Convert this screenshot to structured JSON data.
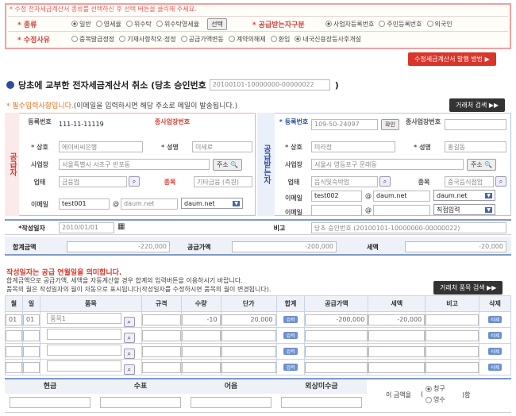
{
  "top": {
    "note": "* 수정 전자세금계산서 종류를 선택하신 후 선택 버튼을 클릭해 주세요.",
    "kind_label": "* 종류",
    "kinds": [
      "일반",
      "영세율",
      "위수탁",
      "위수탁영세율"
    ],
    "select_btn": "선택",
    "recv_label": "* 공급받는자구분",
    "recv": [
      "사업자등록번호",
      "주민등록번호",
      "외국인"
    ],
    "reason_label": "* 수정사유",
    "reasons": [
      "중복발급정정",
      "기재사항착오·정정",
      "공급가액변동",
      "계약의해제",
      "환입",
      "내국신용장등사후개설"
    ],
    "method_btn": "수정세금계산서 발행 방법 ▶"
  },
  "heading": {
    "title": "당초에 교부한 전자세금계산서 취소 (당초 승인번호",
    "approval": "20100101-10000000-00000022",
    "close": ")"
  },
  "required_note": "* 필수입력사항입니다.",
  "required_note2": "(이메일을 입력하시면 해당 주소로 메일이 발송됩니다.)",
  "search_partner": "거래처 검색 ▶▶",
  "supplier": {
    "side": "공급자",
    "reg_label": "등록번호",
    "reg": "111-11-11119",
    "sub_label": "종사업장번호",
    "name_label": "* 상호",
    "name": "에이비씨은행",
    "rep_label": "* 성명",
    "rep": "이세로",
    "addr_label": "사업장",
    "addr": "서울특별시 서초구 반포동",
    "addr_btn": "주소",
    "type_label": "업태",
    "type": "금융업",
    "item_label": "종목",
    "item": "기타금융 (측원)",
    "email_label": "이메일",
    "email_id": "test001",
    "email_domain": "daum.net",
    "email_sel": "daum.net"
  },
  "receiver": {
    "side": "공급받는자",
    "reg_label": "* 등록번호",
    "reg": "109-50-24097",
    "confirm": "확인",
    "sub_label": "종사업장번호",
    "name_label": "* 상호",
    "name": "미라정",
    "rep_label": "* 성명",
    "rep": "홍길동",
    "addr_label": "사업장",
    "addr": "서울시 영등포구 문래동",
    "addr_btn": "주소",
    "type_label": "업태",
    "type": "음식및숙박업",
    "item_label": "종목",
    "item": "중국음식점업",
    "email_label": "이메일",
    "email_id": "test002",
    "email_domain": "daum.net",
    "email_sel": "daum.net",
    "email2_label": "이메일",
    "email2_sel": "직접입력"
  },
  "date_label": "*작성일자",
  "date": "2010/01/01",
  "memo_label": "비고",
  "memo": "당초 승인번호 (20100101-10000000-00000022)",
  "totals": {
    "total_label": "합계금액",
    "total": "-220,000",
    "supply_label": "공급가액",
    "supply": "-200,000",
    "tax_label": "세액",
    "tax": "-20,000"
  },
  "notice": {
    "red": "작성일자는 공급 연월일을 의미합니다.",
    "l1": "합계금액으로 공급가액, 세액을 자동계산할 경우 합계의 입력버튼을 이용하시기 바랍니다.",
    "l2": "품목의 월은 작성일자의 월이 자동으로 표시됩니다(작성일자를 수정하시면 품목의 월이 변경됩니다).",
    "search_items": "거래처 품목 검색 ▶▶"
  },
  "items": {
    "headers": [
      "월",
      "일",
      "품목",
      "규격",
      "수량",
      "단가",
      "합계",
      "공급가액",
      "세액",
      "비고",
      "삭제"
    ],
    "rows": [
      {
        "m": "01",
        "d": "01",
        "name": "품목1",
        "spec": "",
        "qty": "-10",
        "price": "20,000",
        "sum": "입력",
        "supply": "-200,000",
        "tax": "-20,000",
        "note": "",
        "del": "삭제"
      },
      {
        "m": "",
        "d": "",
        "name": "",
        "spec": "",
        "qty": "",
        "price": "",
        "sum": "입력",
        "supply": "",
        "tax": "",
        "note": "",
        "del": "삭제"
      },
      {
        "m": "",
        "d": "",
        "name": "",
        "spec": "",
        "qty": "",
        "price": "",
        "sum": "입력",
        "supply": "",
        "tax": "",
        "note": "",
        "del": "삭제"
      },
      {
        "m": "",
        "d": "",
        "name": "",
        "spec": "",
        "qty": "",
        "price": "",
        "sum": "입력",
        "supply": "",
        "tax": "",
        "note": "",
        "del": "삭제"
      }
    ]
  },
  "payment": {
    "cash": "현금",
    "check": "수표",
    "note": "어음",
    "credit": "외상미수금",
    "claim_pre": "이 금액을",
    "claim_receipt": "영수",
    "claim_charge": "청구",
    "claim_post": ")함",
    "paren": "("
  }
}
